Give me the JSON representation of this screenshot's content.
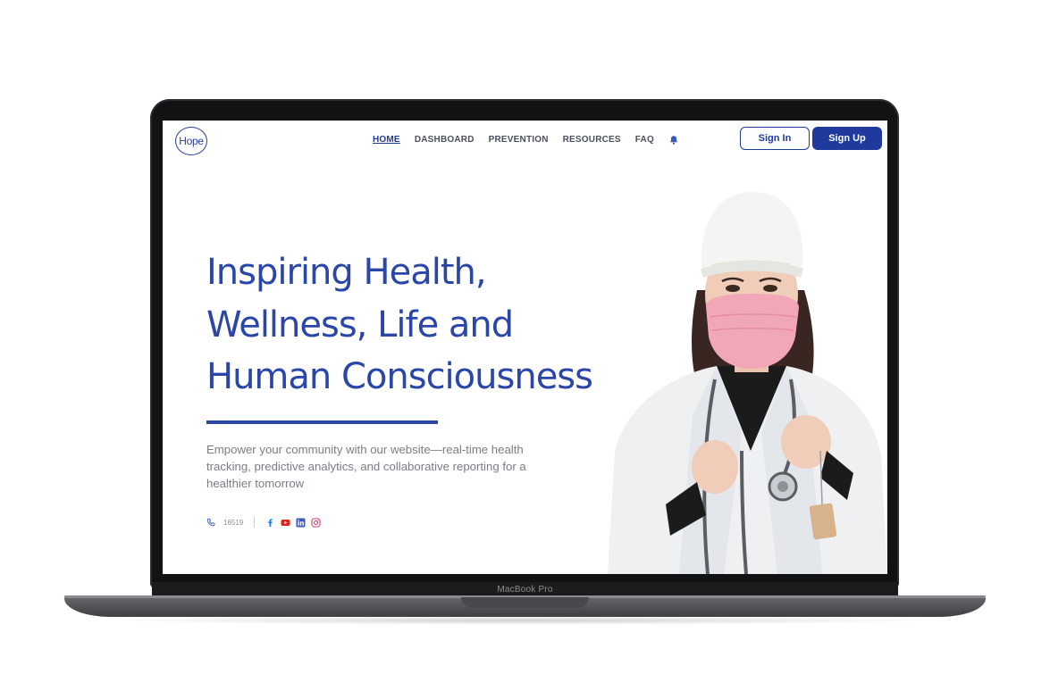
{
  "device": {
    "label": "MacBook Pro"
  },
  "brand": {
    "logo_text": "Hope",
    "primary_color": "#1f3a9c",
    "headline_color": "#2a46a8"
  },
  "nav": {
    "items": [
      {
        "label": "HOME",
        "active": true
      },
      {
        "label": "DASHBOARD",
        "active": false
      },
      {
        "label": "PREVENTION",
        "active": false
      },
      {
        "label": "RESOURCES",
        "active": false
      },
      {
        "label": "FAQ",
        "active": false
      }
    ],
    "notification_icon": "bell-icon",
    "sign_in": "Sign In",
    "sign_up": "Sign Up"
  },
  "hero": {
    "title_lines": [
      "Inspiring Health,",
      "Wellness, Life and",
      "Human Consciousness"
    ],
    "subtitle_lines": [
      "Empower your community with our website—real-time health",
      "tracking, predictive analytics, and collaborative reporting for a",
      "healthier tomorrow"
    ]
  },
  "contact": {
    "phone_icon": "phone-icon",
    "phone_number": "16519",
    "socials": [
      {
        "name": "facebook-icon",
        "color": "#1877f2"
      },
      {
        "name": "youtube-icon",
        "color": "#e62117"
      },
      {
        "name": "linkedin-icon",
        "color": "#3a5bb9"
      },
      {
        "name": "instagram-icon",
        "color": "#e1306c"
      }
    ]
  }
}
